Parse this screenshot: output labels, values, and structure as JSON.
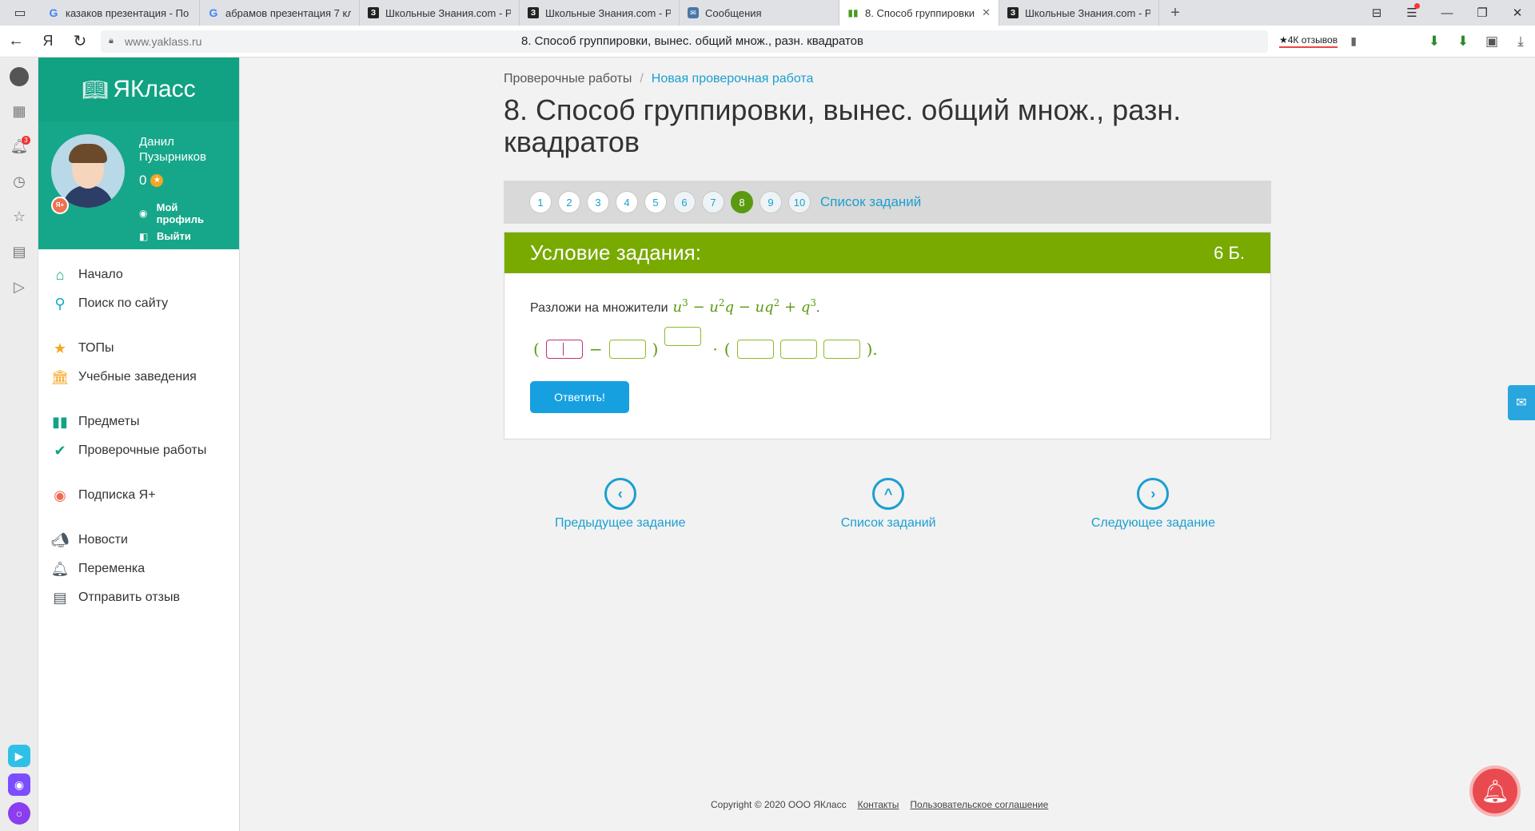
{
  "browser": {
    "tabs": [
      {
        "title": "казаков презентация - По",
        "favicon": "google-icon"
      },
      {
        "title": "абрамов презентация 7 кл",
        "favicon": "google-icon"
      },
      {
        "title": "Школьные Знания.com - Р",
        "favicon": "znania-icon"
      },
      {
        "title": "Школьные Знания.com - Р",
        "favicon": "znania-icon"
      },
      {
        "title": "Сообщения",
        "favicon": "messages-icon"
      },
      {
        "title": "8. Способ группировки",
        "favicon": "yaklass-icon",
        "active": true
      },
      {
        "title": "Школьные Знания.com - Р",
        "favicon": "znania-icon"
      }
    ],
    "url_domain": "www.yaklass.ru",
    "page_heading": "8. Способ группировки, вынес. общий множ., разн. квадратов",
    "reviews_label": "★4К отзывов"
  },
  "side_panel": {
    "notification_count": "3"
  },
  "sidebar": {
    "logo_text": "ЯКласс",
    "profile": {
      "name": "Данил Пузырников",
      "score": "0",
      "my_profile_label": "Мой профиль",
      "logout_label": "Выйти"
    },
    "nav": [
      {
        "label": "Начало",
        "icon": "home-icon"
      },
      {
        "label": "Поиск по сайту",
        "icon": "search-icon"
      },
      {
        "label": "ТОПы",
        "icon": "star-icon"
      },
      {
        "label": "Учебные заведения",
        "icon": "institution-icon"
      },
      {
        "label": "Предметы",
        "icon": "book-icon"
      },
      {
        "label": "Проверочные работы",
        "icon": "check-circle-icon"
      },
      {
        "label": "Подписка Я+",
        "icon": "yaplus-icon"
      },
      {
        "label": "Новости",
        "icon": "megaphone-icon"
      },
      {
        "label": "Переменка",
        "icon": "bell-icon"
      },
      {
        "label": "Отправить отзыв",
        "icon": "feedback-icon"
      }
    ]
  },
  "main": {
    "breadcrumb": {
      "root": "Проверочные работы",
      "separator": "/",
      "current": "Новая проверочная работа"
    },
    "title": "8. Способ группировки, вынес. общий множ., разн. квадратов",
    "task_numbers": [
      "1",
      "2",
      "3",
      "4",
      "5",
      "6",
      "7",
      "8",
      "9",
      "10"
    ],
    "current_task": "8",
    "task_list_link": "Список заданий",
    "task": {
      "header_title": "Условие задания:",
      "points": "6 Б.",
      "question_text": "Разложи на множители",
      "answer_button": "Ответить!"
    },
    "bottom_nav": {
      "prev": "Предыдущее задание",
      "list": "Список заданий",
      "next": "Следующее задание"
    }
  },
  "footer": {
    "copyright": "Copyright © 2020 ООО ЯКласс",
    "contacts": "Контакты",
    "agreement": "Пользовательское соглашение"
  },
  "colors": {
    "brand_teal": "#11a183",
    "task_green": "#78aa00",
    "link_blue": "#1b9fd0",
    "button_blue": "#16a0e0"
  }
}
